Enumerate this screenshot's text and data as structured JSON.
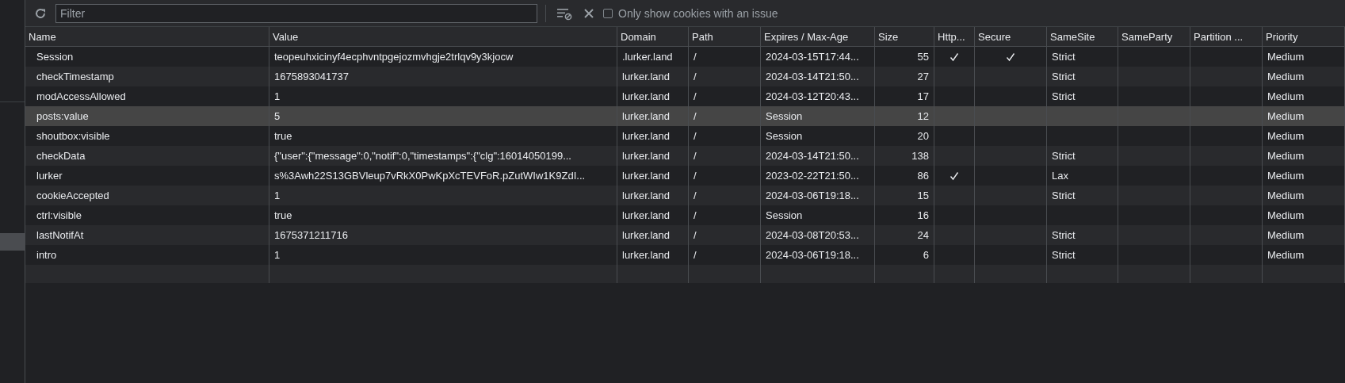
{
  "toolbar": {
    "filter": {
      "placeholder": "Filter"
    },
    "issue_filter": {
      "label": "Only show cookies with an issue",
      "checked": false
    }
  },
  "table": {
    "columns": [
      "Name",
      "Value",
      "Domain",
      "Path",
      "Expires / Max-Age",
      "Size",
      "Http...",
      "Secure",
      "SameSite",
      "SameParty",
      "Partition ...",
      "Priority"
    ],
    "rows": [
      {
        "name": "Session",
        "value": "teopeuhxicinyf4ecphvntpgejozmvhgje2trlqv9y3kjocw",
        "domain": ".lurker.land",
        "path": "/",
        "expires": "2024-03-15T17:44...",
        "size": "55",
        "http_only": true,
        "secure": true,
        "same_site": "Strict",
        "priority": "Medium",
        "selected": false
      },
      {
        "name": "checkTimestamp",
        "value": "1675893041737",
        "domain": "lurker.land",
        "path": "/",
        "expires": "2024-03-14T21:50...",
        "size": "27",
        "http_only": false,
        "secure": false,
        "same_site": "Strict",
        "priority": "Medium",
        "selected": false
      },
      {
        "name": "modAccessAllowed",
        "value": "1",
        "domain": "lurker.land",
        "path": "/",
        "expires": "2024-03-12T20:43...",
        "size": "17",
        "http_only": false,
        "secure": false,
        "same_site": "Strict",
        "priority": "Medium",
        "selected": false
      },
      {
        "name": "posts:value",
        "value": "5",
        "domain": "lurker.land",
        "path": "/",
        "expires": "Session",
        "size": "12",
        "http_only": false,
        "secure": false,
        "priority": "Medium",
        "selected": true
      },
      {
        "name": "shoutbox:visible",
        "value": "true",
        "domain": "lurker.land",
        "path": "/",
        "expires": "Session",
        "size": "20",
        "http_only": false,
        "secure": false,
        "priority": "Medium",
        "selected": false
      },
      {
        "name": "checkData",
        "value": "{\"user\":{\"message\":0,\"notif\":0,\"timestamps\":{\"clg\":16014050199...",
        "domain": "lurker.land",
        "path": "/",
        "expires": "2024-03-14T21:50...",
        "size": "138",
        "http_only": false,
        "secure": false,
        "same_site": "Strict",
        "priority": "Medium",
        "selected": false
      },
      {
        "name": "lurker",
        "value": "s%3Awh22S13GBVleup7vRkX0PwKpXcTEVFoR.pZutWIw1K9ZdI...",
        "domain": "lurker.land",
        "path": "/",
        "expires": "2023-02-22T21:50...",
        "size": "86",
        "http_only": true,
        "secure": false,
        "same_site": "Lax",
        "priority": "Medium",
        "selected": false
      },
      {
        "name": "cookieAccepted",
        "value": "1",
        "domain": "lurker.land",
        "path": "/",
        "expires": "2024-03-06T19:18...",
        "size": "15",
        "http_only": false,
        "secure": false,
        "same_site": "Strict",
        "priority": "Medium",
        "selected": false
      },
      {
        "name": "ctrl:visible",
        "value": "true",
        "domain": "lurker.land",
        "path": "/",
        "expires": "Session",
        "size": "16",
        "http_only": false,
        "secure": false,
        "priority": "Medium",
        "selected": false
      },
      {
        "name": "lastNotifAt",
        "value": "1675371211716",
        "domain": "lurker.land",
        "path": "/",
        "expires": "2024-03-08T20:53...",
        "size": "24",
        "http_only": false,
        "secure": false,
        "same_site": "Strict",
        "priority": "Medium",
        "selected": false
      },
      {
        "name": "intro",
        "value": "1",
        "domain": "lurker.land",
        "path": "/",
        "expires": "2024-03-06T19:18...",
        "size": "6",
        "http_only": false,
        "secure": false,
        "same_site": "Strict",
        "priority": "Medium",
        "selected": false
      }
    ]
  }
}
